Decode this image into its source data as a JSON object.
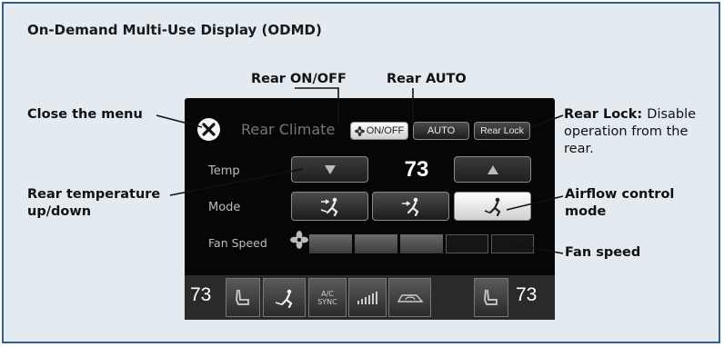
{
  "title": "On-Demand Multi-Use Display (ODMD)",
  "callouts": {
    "rear_on_off": "Rear ON/OFF",
    "rear_auto": "Rear AUTO",
    "close_menu": "Close the menu",
    "rear_lock_bold": "Rear Lock:",
    "rear_lock_desc_1": "Disable",
    "rear_lock_desc_2": "operation from the",
    "rear_lock_desc_3": "rear.",
    "rear_temp_1": "Rear temperature",
    "rear_temp_2": "up/down",
    "airflow_1": "Airflow control",
    "airflow_2": "mode",
    "fan_speed": "Fan speed"
  },
  "screen": {
    "heading": "Rear Climate",
    "on_off_label": "ON/OFF",
    "auto_label": "AUTO",
    "rear_lock_label": "Rear Lock",
    "temp_label": "Temp",
    "temp_value": "73",
    "mode_label": "Mode",
    "fan_speed_label": "Fan Speed",
    "fan_level": 0.6,
    "left_temp": "73",
    "right_temp": "73",
    "ac_label": "A/C",
    "sync_label": "SYNC"
  },
  "icons": [
    "close-icon",
    "fan-icon",
    "down-arrow-icon",
    "up-arrow-icon",
    "airflow-face-feet-icon",
    "airflow-face-icon",
    "airflow-feet-icon",
    "seat-heater-icon",
    "recirculation-icon"
  ],
  "colors": {
    "frame_border": "#2f5f8a",
    "panel_bg": "#e3eaf0",
    "screen_bg": "#060606"
  }
}
